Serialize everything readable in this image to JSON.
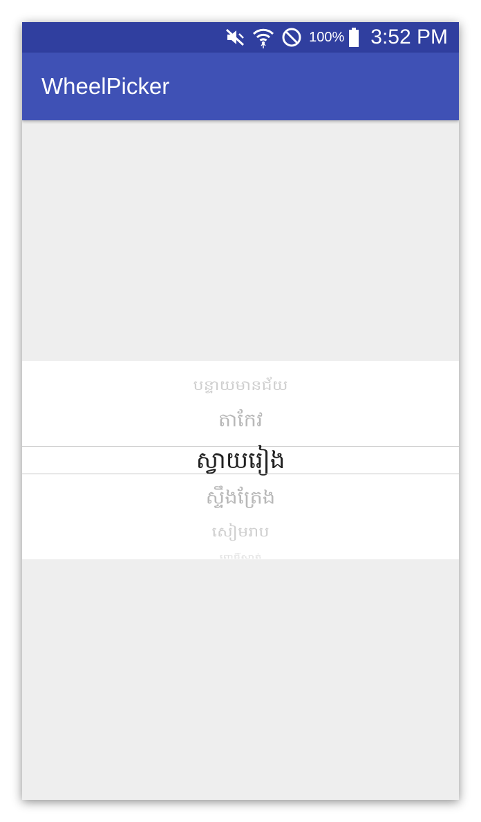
{
  "status_bar": {
    "battery_percent": "100%",
    "time": "3:52 PM",
    "icons": [
      "mute-icon",
      "wifi-icon",
      "do-not-disturb-icon",
      "battery-icon"
    ]
  },
  "app_bar": {
    "title": "WheelPicker"
  },
  "wheel_picker": {
    "items": [
      "បន្ទាយមានជ័យ",
      "តាកែវ",
      "ស្វាយរៀង",
      "ស្ទឹងត្រែង",
      "សៀមរាប",
      "ពោធិ៍សាត់"
    ],
    "selected_index": 2,
    "selected_value": "ស្វាយរៀង"
  },
  "colors": {
    "status_bar": "#303f9f",
    "app_bar": "#3f51b5",
    "background": "#eeeeee",
    "wheel_background": "#ffffff",
    "selected_text": "#222222",
    "unselected_text": "#b8b8b8"
  }
}
